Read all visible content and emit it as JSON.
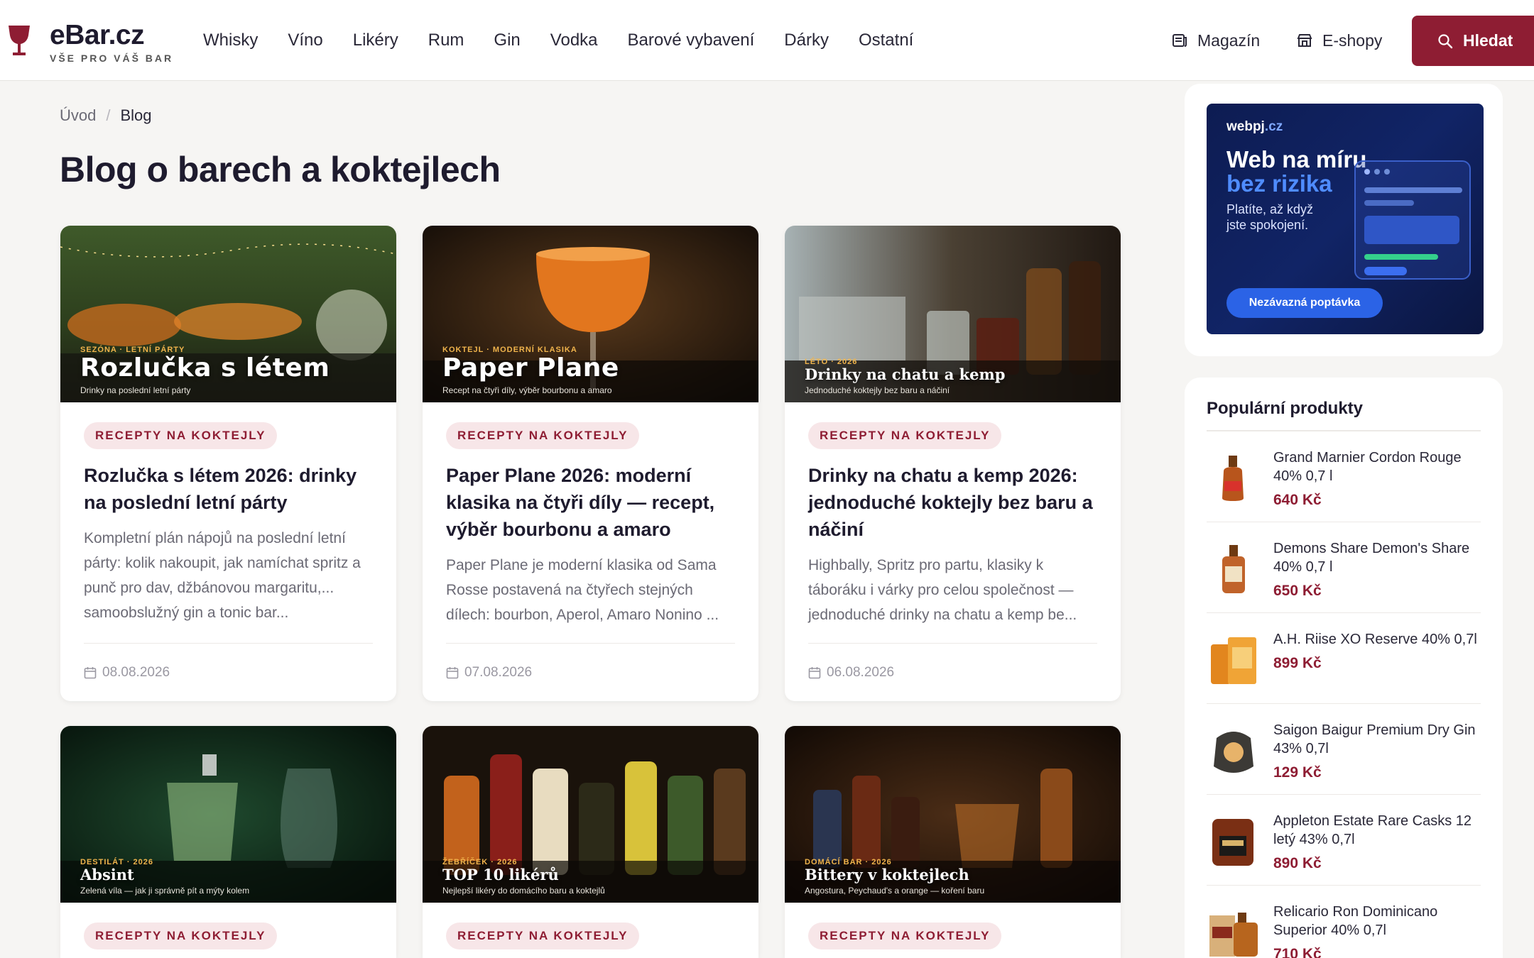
{
  "header": {
    "logo_title": "eBar.cz",
    "logo_sub": "VŠE PRO VÁŠ BAR",
    "nav": [
      "Whisky",
      "Víno",
      "Likéry",
      "Rum",
      "Gin",
      "Vodka",
      "Barové vybavení",
      "Dárky",
      "Ostatní"
    ],
    "magazine_label": "Magazín",
    "eshops_label": "E-shopy",
    "search_label": "Hledat",
    "accent": "#8e1d33"
  },
  "breadcrumb": {
    "home": "Úvod",
    "separator": "/",
    "current": "Blog"
  },
  "page_title": "Blog o barech a koktejlech",
  "cards": [
    {
      "kicker": "SEZÓNA · LETNÍ PÁRTY",
      "image_title": "Rozlučka s létem",
      "image_sub": "Drinky na poslední letní párty",
      "badge": "RECEPTY NA KOKTEJLY",
      "title": "Rozlučka s létem 2026: drinky na poslední letní párty",
      "excerpt": "Kompletní plán nápojů na poslední letní párty: kolik nakoupit, jak namíchat spritz a punč pro dav, džbánovou margaritu,... samoobslužný gin a tonic bar...",
      "date": "08.08.2026"
    },
    {
      "kicker": "KOKTEJL · MODERNÍ KLASIKA",
      "image_title": "Paper Plane",
      "image_sub": "Recept na čtyři díly, výběr bourbonu a amaro",
      "badge": "RECEPTY NA KOKTEJLY",
      "title": "Paper Plane 2026: moderní klasika na čtyři díly — recept, výběr bourbonu a amaro",
      "excerpt": "Paper Plane je moderní klasika od Sama Rosse postavená na čtyřech stejných dílech: bourbon, Aperol, Amaro Nonino ...",
      "date": "07.08.2026"
    },
    {
      "kicker": "LÉTO · 2026",
      "image_title": "Drinky na chatu a kemp",
      "image_sub": "Jednoduché koktejly bez baru a náčiní",
      "badge": "RECEPTY NA KOKTEJLY",
      "title": "Drinky na chatu a kemp 2026: jednoduché koktejly bez baru a náčiní",
      "excerpt": "Highbally, Spritz pro partu, klasiky k táboráku i várky pro celou společnost — jednoduché drinky na chatu a kemp be...",
      "date": "06.08.2026"
    },
    {
      "kicker": "DESTILÁT · 2026",
      "image_title": "Absint",
      "image_sub": "Zelená víla — jak ji správně pít a mýty kolem",
      "badge": "RECEPTY NA KOKTEJLY"
    },
    {
      "kicker": "ŽEBŘÍČEK · 2026",
      "image_title": "TOP 10 likérů",
      "image_sub": "Nejlepší likéry do domácího baru a koktejlů",
      "badge": "RECEPTY NA KOKTEJLY"
    },
    {
      "kicker": "DOMÁCÍ BAR · 2026",
      "image_title": "Bittery v koktejlech",
      "image_sub": "Angostura, Peychaud's a orange — koření baru",
      "badge": "RECEPTY NA KOKTEJLY"
    }
  ],
  "ad": {
    "brand": "webpj",
    "brand_tld": ".cz",
    "headline_1": "Web na míru",
    "headline_2": "bez rizika",
    "text": "Platíte, až když jste spokojení.",
    "cta": "Nezávazná poptávka"
  },
  "popular": {
    "title": "Populární produkty",
    "items": [
      {
        "name": "Grand Marnier Cordon Rouge 40% 0,7 l",
        "price": "640 Kč"
      },
      {
        "name": "Demons Share Demon's Share 40% 0,7 l",
        "price": "650 Kč"
      },
      {
        "name": "A.H. Riise XO Reserve 40% 0,7l",
        "price": "899 Kč"
      },
      {
        "name": "Saigon Baigur Premium Dry Gin 43% 0,7l",
        "price": "129 Kč"
      },
      {
        "name": "Appleton Estate Rare Casks 12 letý 43% 0,7l",
        "price": "890 Kč"
      },
      {
        "name": "Relicario Ron Dominicano Superior 40% 0,7l",
        "price": "710 Kč"
      }
    ]
  }
}
